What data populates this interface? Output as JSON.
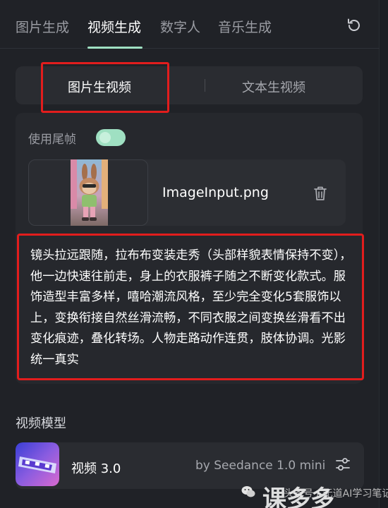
{
  "tabs": [
    {
      "label": "图片生成"
    },
    {
      "label": "视频生成",
      "active": true
    },
    {
      "label": "数字人"
    },
    {
      "label": "音乐生成"
    }
  ],
  "mode_switch": {
    "options": [
      "图片生视频",
      "文本生视频"
    ],
    "selected": "图片生视频"
  },
  "toggle": {
    "label": "使用尾帧",
    "on": true
  },
  "upload": {
    "filename": "ImageInput.png"
  },
  "prompt": {
    "text": "镜头拉远跟随，拉布布变装走秀（头部样貌表情保持不变），他一边快速往前走，身上的衣服裤子随之不断变化款式。服饰造型丰富多样，嘻哈潮流风格，至少完全变化5套服饰以上，变换衔接自然丝滑流畅，不同衣服之间变换丝滑看不出变化痕迹，叠化转场。人物走路动作连贯，肢体协调。光影统一真实"
  },
  "model": {
    "section_title": "视频模型",
    "name": "视频 3.0",
    "by": "by Seedance 1.0 mini"
  },
  "watermark": {
    "text": "头条号 / 无道AI学习笔记",
    "logo_text": "课多多"
  },
  "colors": {
    "accent": "#9fe0c2",
    "highlight": "#e21d1d",
    "background": "#202227"
  },
  "icons": [
    "refresh-icon",
    "trash-icon",
    "settings-icon",
    "wechat-icon"
  ]
}
